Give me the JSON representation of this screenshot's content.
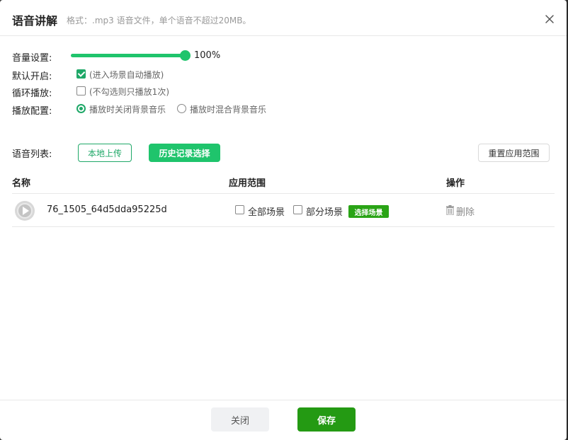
{
  "dialog": {
    "title": "语音讲解",
    "subtitle": "格式：.mp3 语音文件，单个语音不超过20MB。"
  },
  "settings": {
    "volume": {
      "label": "音量设置:",
      "value": 100,
      "value_text": "100%"
    },
    "autoplay": {
      "label": "默认开启:",
      "checked": true,
      "hint": "(进入场景自动播放)"
    },
    "loop": {
      "label": "循环播放:",
      "checked": false,
      "hint": "(不勾选则只播放1次)"
    },
    "playback": {
      "label": "播放配置:",
      "options": [
        "播放时关闭背景音乐",
        "播放时混合背景音乐"
      ],
      "selected": "播放时关闭背景音乐"
    }
  },
  "list": {
    "label": "语音列表:",
    "upload_label": "本地上传",
    "history_label": "历史记录选择",
    "reset_label": "重置应用范围",
    "columns": [
      "名称",
      "应用范围",
      "操作"
    ],
    "rows": [
      {
        "name": "76_1505_64d5dda95225d",
        "all_scenes_label": "全部场景",
        "all_scenes_checked": false,
        "partial_scenes_label": "部分场景",
        "partial_scenes_checked": false,
        "select_scene_label": "选择场景",
        "delete_label": "删除"
      }
    ]
  },
  "footer": {
    "close_label": "关闭",
    "save_label": "保存"
  },
  "colors": {
    "accent_green": "#1fc46c",
    "check_green": "#1fa868",
    "save_green": "#249a13",
    "badge_green": "#2aa416"
  },
  "icons": [
    "close-icon",
    "play-icon",
    "trash-icon"
  ]
}
